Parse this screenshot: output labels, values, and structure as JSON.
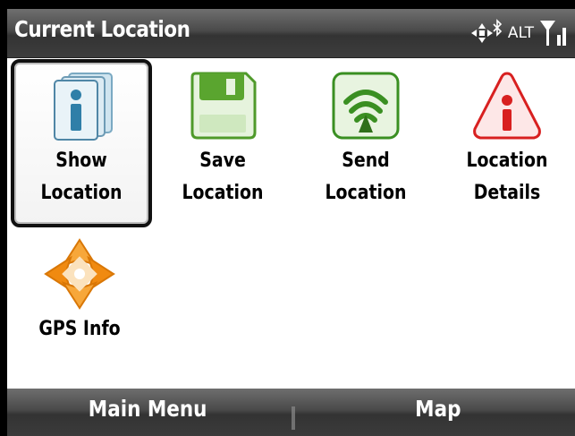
{
  "title": "Current Location",
  "status": {
    "bluetooth_icon": "bluetooth-icon",
    "move_icon": "gps-arrows-icon",
    "alt_text": "ALT",
    "signal_icon": "signal-strength-icon"
  },
  "tiles": [
    {
      "label": "Show\nLocation",
      "icon": "info-pages-icon"
    },
    {
      "label": "Save\nLocation",
      "icon": "floppy-disk-icon"
    },
    {
      "label": "Send\nLocation",
      "icon": "broadcast-icon"
    },
    {
      "label": "Location\nDetails",
      "icon": "warning-info-icon"
    },
    {
      "label": "GPS Info",
      "icon": "gps-compass-icon"
    }
  ],
  "softkeys": {
    "left": "Main Menu",
    "right": "Map"
  },
  "colors": {
    "bar_dark": "#333333",
    "selection_border": "#111111",
    "save_green": "#5aa52f",
    "send_green": "#3a8f22",
    "details_red": "#d82020",
    "gps_orange": "#f08a10",
    "info_blue": "#2f7fa8"
  }
}
